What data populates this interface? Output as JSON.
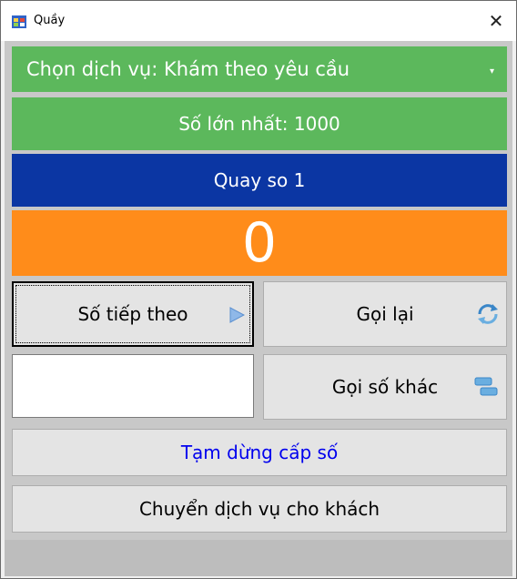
{
  "window": {
    "title": "Quầy",
    "close_glyph": "✕",
    "app_icon": "winforms-app-icon"
  },
  "service": {
    "label": "Chọn dịch vụ: Khám theo yêu cầu",
    "dropdown_glyph": "▾",
    "color": "#5cb85c"
  },
  "max_number": {
    "label": "Số lớn nhất: 1000",
    "color": "#5cb85c"
  },
  "counter": {
    "label": "Quay so 1",
    "color": "#0b36a3"
  },
  "current_number": {
    "value": "0",
    "color": "#ff8c1a"
  },
  "buttons": {
    "next": {
      "label": "Số tiếp theo",
      "icon": "play-icon"
    },
    "recall": {
      "label": "Gọi lại",
      "icon": "refresh-icon"
    },
    "call_other": {
      "label": "Gọi số khác",
      "icon": "stack-icon"
    },
    "pause": {
      "label": "Tạm dừng cấp số"
    },
    "transfer": {
      "label": "Chuyển dịch vụ cho khách"
    }
  },
  "input": {
    "value": ""
  }
}
